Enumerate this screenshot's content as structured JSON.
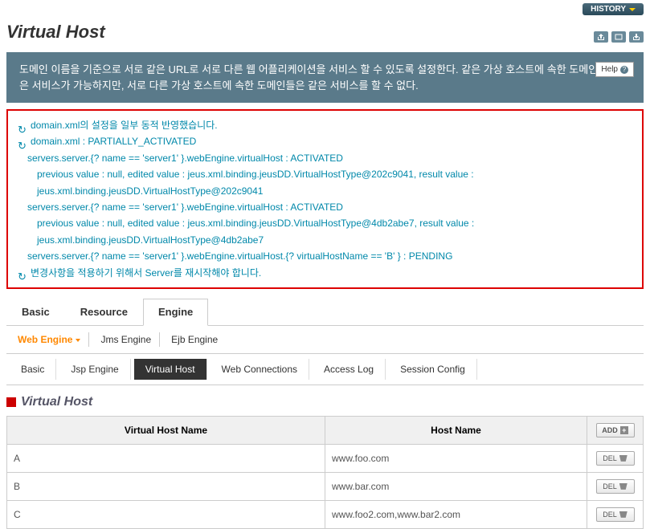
{
  "header": {
    "history_label": "HISTORY",
    "title": "Virtual Host"
  },
  "description": {
    "text": "도메인 이름을 기준으로 서로 같은 URL로 서로 다른 웹 어플리케이션을 서비스 할 수 있도록 설정한다. 같은 가상 호스트에 속한 도메인들은 같은 서비스가 가능하지만, 서로 다른 가상 호스트에 속한 도메인들은 같은 서비스를 할 수 없다.",
    "help_label": "Help"
  },
  "status": {
    "lines": [
      "domain.xml의 설정을 일부 동적 반영했습니다.",
      "domain.xml : PARTIALLY_ACTIVATED",
      "servers.server.{? name == 'server1' }.webEngine.virtualHost : ACTIVATED",
      "previous value : null, edited value : jeus.xml.binding.jeusDD.VirtualHostType@202c9041, result value : jeus.xml.binding.jeusDD.VirtualHostType@202c9041",
      "servers.server.{? name == 'server1' }.webEngine.virtualHost : ACTIVATED",
      "previous value : null, edited value : jeus.xml.binding.jeusDD.VirtualHostType@4db2abe7, result value : jeus.xml.binding.jeusDD.VirtualHostType@4db2abe7",
      "servers.server.{? name == 'server1' }.webEngine.virtualHost.{? virtualHostName == 'B' } : PENDING",
      "변경사항을 적용하기 위해서 Server를 재시작해야 합니다."
    ]
  },
  "tabs1": {
    "items": [
      "Basic",
      "Resource",
      "Engine"
    ],
    "active": 2
  },
  "tabs2": {
    "items": [
      "Web Engine",
      "Jms Engine",
      "Ejb Engine"
    ],
    "active": 0
  },
  "tabs3": {
    "items": [
      "Basic",
      "Jsp Engine",
      "Virtual Host",
      "Web Connections",
      "Access Log",
      "Session Config"
    ],
    "active": 2
  },
  "section": {
    "title": "Virtual Host"
  },
  "table": {
    "headers": [
      "Virtual Host Name",
      "Host Name"
    ],
    "add_label": "ADD",
    "del_label": "DEL",
    "rows": [
      {
        "name": "A",
        "host": "www.foo.com"
      },
      {
        "name": "B",
        "host": "www.bar.com"
      },
      {
        "name": "C",
        "host": "www.foo2.com,www.bar2.com"
      }
    ]
  }
}
